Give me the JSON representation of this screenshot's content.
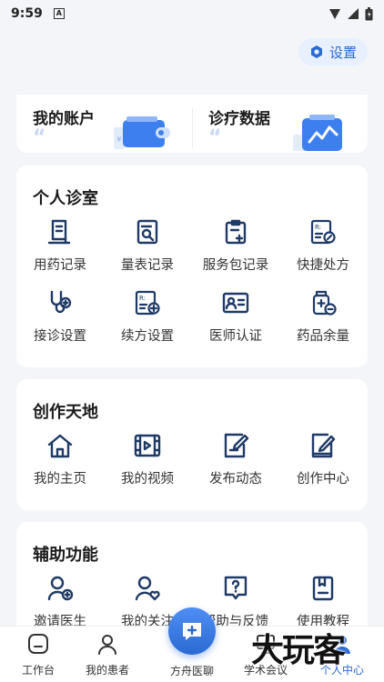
{
  "status": {
    "time": "9:59",
    "notif_letter": "A"
  },
  "header": {
    "settings_label": "设置"
  },
  "top_card": {
    "left_title": "我的账户",
    "right_title": "诊疗数据",
    "quote_mark": "“"
  },
  "sections": [
    {
      "title": "个人诊室",
      "items": [
        {
          "label": "用药记录",
          "icon": "medication-record-icon"
        },
        {
          "label": "量表记录",
          "icon": "scale-record-icon"
        },
        {
          "label": "服务包记录",
          "icon": "service-package-icon"
        },
        {
          "label": "快捷处方",
          "icon": "quick-prescription-icon"
        },
        {
          "label": "接诊设置",
          "icon": "stethoscope-icon"
        },
        {
          "label": "续方设置",
          "icon": "renew-prescription-icon"
        },
        {
          "label": "医师认证",
          "icon": "doctor-id-card-icon"
        },
        {
          "label": "药品余量",
          "icon": "medicine-stock-icon"
        }
      ]
    },
    {
      "title": "创作天地",
      "items": [
        {
          "label": "我的主页",
          "icon": "home-icon"
        },
        {
          "label": "我的视频",
          "icon": "video-icon"
        },
        {
          "label": "发布动态",
          "icon": "edit-post-icon"
        },
        {
          "label": "创作中心",
          "icon": "creation-center-icon"
        }
      ]
    },
    {
      "title": "辅助功能",
      "items": [
        {
          "label": "邀请医生",
          "icon": "invite-doctor-icon"
        },
        {
          "label": "我的关注",
          "icon": "my-follow-icon"
        },
        {
          "label": "帮助与反馈",
          "icon": "help-feedback-icon"
        },
        {
          "label": "使用教程",
          "icon": "tutorial-book-icon"
        }
      ]
    }
  ],
  "bottom_nav": [
    {
      "label": "工作台",
      "icon": "workbench-icon",
      "active": false
    },
    {
      "label": "我的患者",
      "icon": "patients-icon",
      "active": false
    },
    {
      "label": "方舟医聊",
      "icon": "chat-plus-icon",
      "active": false
    },
    {
      "label": "学术会议",
      "icon": "meeting-icon",
      "active": false
    },
    {
      "label": "个人中心",
      "icon": "profile-icon",
      "active": true
    }
  ],
  "watermark": "大玩客",
  "colors": {
    "accent": "#2b6ad1",
    "icon_stroke": "#1f3a66",
    "background": "#f4f5f8"
  }
}
